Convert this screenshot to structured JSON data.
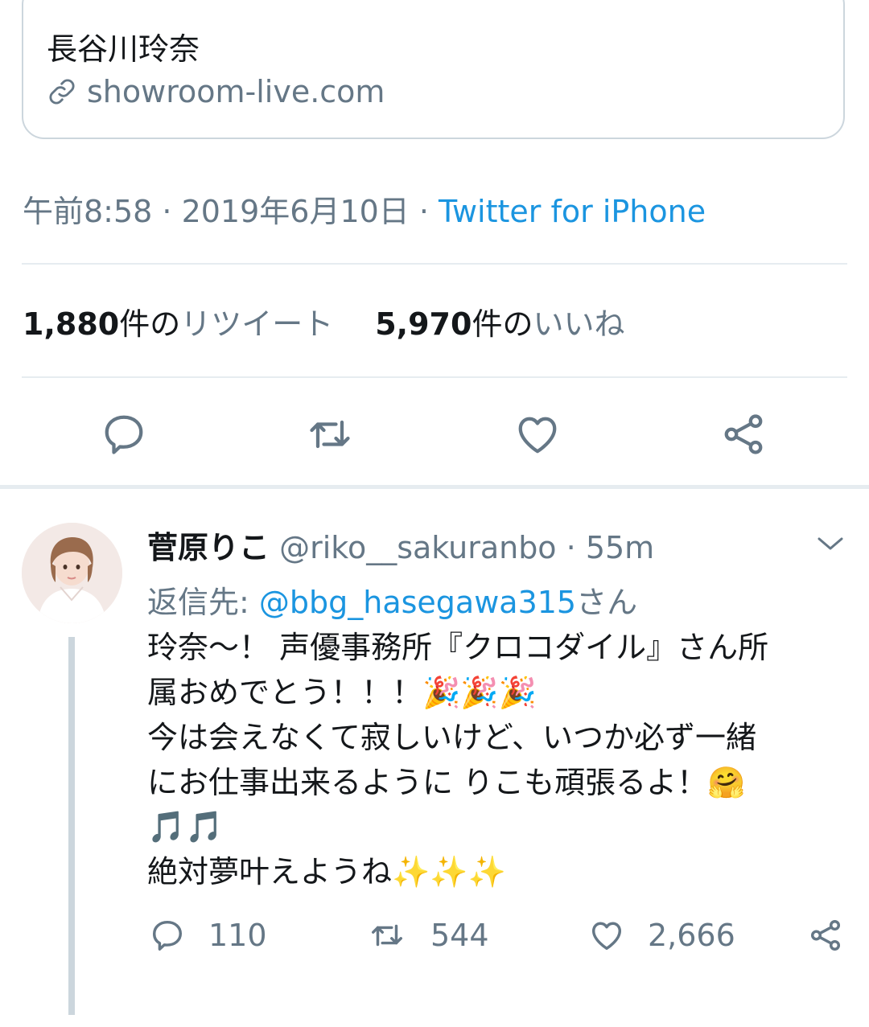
{
  "link_card": {
    "title": "長谷川玲奈",
    "domain": "showroom-live.com"
  },
  "meta": {
    "time_date": "午前8:58 · 2019年6月10日 · ",
    "source": "Twitter for iPhone"
  },
  "stats": {
    "retweet_count": "1,880",
    "retweet_unit": "件の",
    "retweet_label": "リツイート",
    "like_count": "5,970",
    "like_unit": "件の",
    "like_label": "いいね"
  },
  "action_icons": [
    "reply-icon",
    "retweet-icon",
    "like-icon",
    "share-icon"
  ],
  "reply": {
    "name": "菅原りこ",
    "handle": "@riko__sakuranbo",
    "separator": " · ",
    "time": "55m",
    "reply_to_label": "返信先: ",
    "reply_to_mention": "@bbg_hasegawa315",
    "reply_to_suffix": "さん",
    "lines": [
      "玲奈〜！ 声優事務所『クロコダイル』さん所",
      "属おめでとう！！！🎉🎉🎉",
      "今は会えなくて寂しいけど、いつか必ず一緒",
      "にお仕事出来るように りこも頑張るよ！🤗",
      "🎵🎵",
      "絶対夢叶えようね✨✨✨"
    ],
    "reply_count": "110",
    "retweet_count": "544",
    "like_count": "2,666"
  },
  "colors": {
    "accent": "#1b95e0",
    "secondary_text": "#657786",
    "divider": "#e6ecf0",
    "border": "#ccd6dd"
  }
}
